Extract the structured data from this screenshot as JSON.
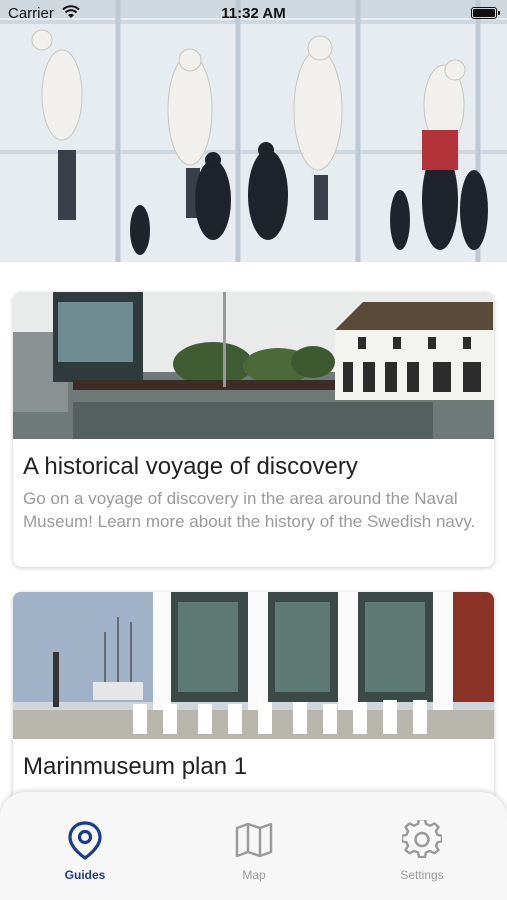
{
  "status_bar": {
    "carrier": "Carrier",
    "time": "11:32 AM"
  },
  "hero": {
    "icon": "museum-statues-photo"
  },
  "guides": [
    {
      "title": "A historical voyage of discovery",
      "description": "Go on a voyage of discovery in the area around the Naval Museum! Learn more about the history of the Swedish navy."
    },
    {
      "title": "Marinmuseum plan 1",
      "description": ""
    }
  ],
  "tabs": [
    {
      "label": "Guides",
      "icon": "location-pin-icon",
      "active": true
    },
    {
      "label": "Map",
      "icon": "map-icon",
      "active": false
    },
    {
      "label": "Settings",
      "icon": "gear-icon",
      "active": false
    }
  ],
  "colors": {
    "accent": "#1a3c8c",
    "inactive": "#9a9a9a"
  }
}
